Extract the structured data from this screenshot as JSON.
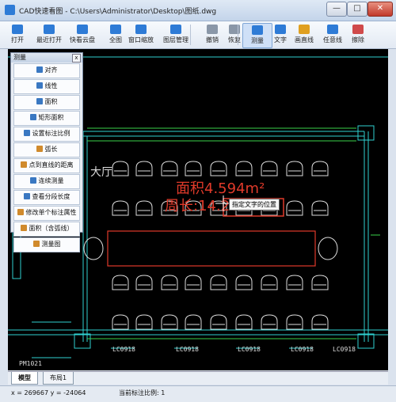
{
  "window": {
    "title": "CAD快速看图 - C:\\Users\\Administrator\\Desktop\\图纸.dwg",
    "min_symbol": "—",
    "max_symbol": "□",
    "close_symbol": "✕"
  },
  "toolbar": {
    "items": [
      {
        "label": "打开",
        "icon": "folder-open-icon"
      },
      {
        "label": "最近打开",
        "icon": "clock-icon"
      },
      {
        "label": "快看云盘",
        "icon": "cloud-icon"
      },
      {
        "label": "全图",
        "icon": "fit-screen-icon"
      },
      {
        "label": "窗口缩放",
        "icon": "zoom-window-icon"
      },
      {
        "label": "图层管理",
        "icon": "layers-icon"
      },
      {
        "label": "撤销",
        "icon": "undo-icon"
      },
      {
        "label": "恢复",
        "icon": "redo-icon"
      },
      {
        "label": "测量",
        "icon": "measure-icon"
      },
      {
        "label": "文字",
        "icon": "text-icon"
      },
      {
        "label": "画直线",
        "icon": "line-icon"
      },
      {
        "label": "任意线",
        "icon": "pen-icon"
      },
      {
        "label": "擦除",
        "icon": "eraser-icon"
      }
    ]
  },
  "panel": {
    "title": "测量",
    "close_symbol": "x",
    "items": [
      {
        "label": "对齐",
        "color": "#3a78c2"
      },
      {
        "label": "线性",
        "color": "#3a78c2"
      },
      {
        "label": "面积",
        "color": "#3a78c2"
      },
      {
        "label": "矩形面积",
        "color": "#3a78c2"
      },
      {
        "label": "设置标注比例",
        "color": "#3a78c2"
      },
      {
        "label": "弧长",
        "color": "#d08a2c"
      },
      {
        "label": "点到直线的距离",
        "color": "#d08a2c"
      },
      {
        "label": "连续测量",
        "color": "#3a78c2"
      },
      {
        "label": "查看分段长度",
        "color": "#3a78c2"
      },
      {
        "label": "修改单个标注属性",
        "color": "#d08a2c"
      },
      {
        "label": "面积（含弧线）",
        "color": "#d08a2c"
      },
      {
        "label": "测量图",
        "color": "#d08a2c"
      }
    ]
  },
  "drawing": {
    "area_text": "面积4.594m²",
    "perimeter_text": "周长:14.20m",
    "tooltip": "指定文字的位置",
    "hall_label": "大厅",
    "room_label": "PM1021",
    "window_labels": [
      "LC0918",
      "LC0918",
      "LC0918",
      "LC0918",
      "LC0918"
    ]
  },
  "tabs": [
    "模型",
    "布局1"
  ],
  "status": {
    "coords": "x = 269667  y = -24064",
    "scale": "当前标注比例: 1"
  },
  "colors": {
    "accent": "#2e7bd6",
    "measure_red": "#e03a2a",
    "cad_cyan": "#2fd1d1",
    "cad_green": "#3ad24a"
  }
}
